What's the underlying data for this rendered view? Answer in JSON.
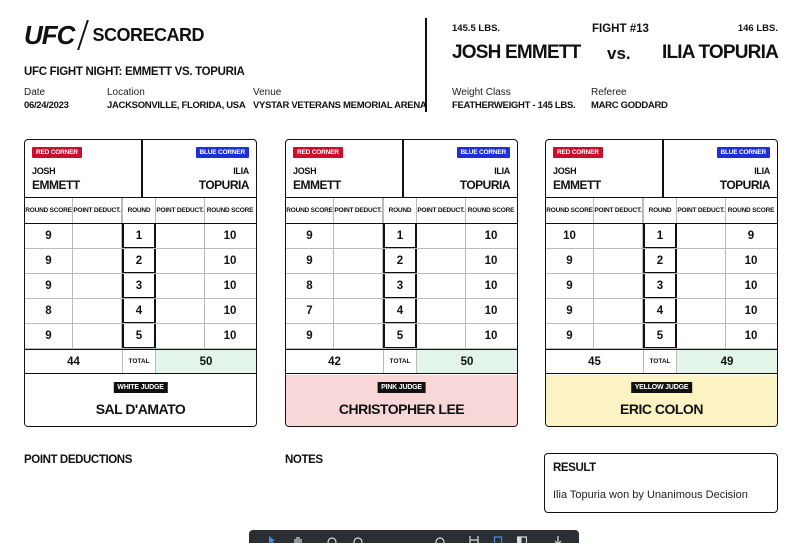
{
  "header": {
    "logo_text": "UFC",
    "logo_sub": "SCORECARD",
    "event_title": "UFC FIGHT NIGHT: EMMETT VS. TOPURIA",
    "date_label": "Date",
    "date_value": "06/24/2023",
    "location_label": "Location",
    "location_value": "JACKSONVILLE, FLORIDA, USA",
    "venue_label": "Venue",
    "venue_value": "VYSTAR VETERANS MEMORIAL ARENA"
  },
  "fight": {
    "red_weight": "145.5 LBS.",
    "fight_number": "FIGHT #13",
    "blue_weight": "146 LBS.",
    "red_name": "JOSH EMMETT",
    "vs": "vs.",
    "blue_name": "ILIA TOPURIA",
    "weight_class_label": "Weight Class",
    "weight_class_value": "FEATHERWEIGHT - 145 LBS.",
    "referee_label": "Referee",
    "referee_value": "MARC GODDARD"
  },
  "card_labels": {
    "red_corner": "RED CORNER",
    "blue_corner": "BLUE CORNER",
    "red_first": "JOSH",
    "red_last": "EMMETT",
    "blue_first": "ILIA",
    "blue_last": "TOPURIA",
    "round_score": "ROUND SCORE",
    "point_deduct": "POINT DEDUCT.",
    "round": "ROUND",
    "total": "TOTAL"
  },
  "cards": [
    {
      "judge_badge": "WHITE JUDGE",
      "judge_name": "SAL D'AMATO",
      "judge_bg": "#ffffff",
      "rounds": [
        {
          "round": "1",
          "red": "9",
          "red_deduct": "",
          "blue_deduct": "",
          "blue": "10"
        },
        {
          "round": "2",
          "red": "9",
          "red_deduct": "",
          "blue_deduct": "",
          "blue": "10"
        },
        {
          "round": "3",
          "red": "9",
          "red_deduct": "",
          "blue_deduct": "",
          "blue": "10"
        },
        {
          "round": "4",
          "red": "8",
          "red_deduct": "",
          "blue_deduct": "",
          "blue": "10"
        },
        {
          "round": "5",
          "red": "9",
          "red_deduct": "",
          "blue_deduct": "",
          "blue": "10"
        }
      ],
      "red_total": "44",
      "blue_total": "50"
    },
    {
      "judge_badge": "PINK JUDGE",
      "judge_name": "CHRISTOPHER LEE",
      "judge_bg": "#f8d7d9",
      "rounds": [
        {
          "round": "1",
          "red": "9",
          "red_deduct": "",
          "blue_deduct": "",
          "blue": "10"
        },
        {
          "round": "2",
          "red": "9",
          "red_deduct": "",
          "blue_deduct": "",
          "blue": "10"
        },
        {
          "round": "3",
          "red": "8",
          "red_deduct": "",
          "blue_deduct": "",
          "blue": "10"
        },
        {
          "round": "4",
          "red": "7",
          "red_deduct": "",
          "blue_deduct": "",
          "blue": "10"
        },
        {
          "round": "5",
          "red": "9",
          "red_deduct": "",
          "blue_deduct": "",
          "blue": "10"
        }
      ],
      "red_total": "42",
      "blue_total": "50"
    },
    {
      "judge_badge": "YELLOW JUDGE",
      "judge_name": "ERIC COLON",
      "judge_bg": "#fbf3c4",
      "rounds": [
        {
          "round": "1",
          "red": "10",
          "red_deduct": "",
          "blue_deduct": "",
          "blue": "9"
        },
        {
          "round": "2",
          "red": "9",
          "red_deduct": "",
          "blue_deduct": "",
          "blue": "10"
        },
        {
          "round": "3",
          "red": "9",
          "red_deduct": "",
          "blue_deduct": "",
          "blue": "10"
        },
        {
          "round": "4",
          "red": "9",
          "red_deduct": "",
          "blue_deduct": "",
          "blue": "10"
        },
        {
          "round": "5",
          "red": "9",
          "red_deduct": "",
          "blue_deduct": "",
          "blue": "10"
        }
      ],
      "red_total": "45",
      "blue_total": "49"
    }
  ],
  "bottom": {
    "point_deductions_title": "POINT DEDUCTIONS",
    "notes_title": "NOTES",
    "result_title": "RESULT",
    "result_text": "Ilia Topuria won by Unanimous Decision"
  },
  "toolbar": {
    "icons": [
      "cursor-icon",
      "hand-icon",
      "zoom-out-icon",
      "zoom-in-icon",
      "stamp-icon",
      "fit-width-icon",
      "page-icon",
      "sidebar-icon",
      "download-icon"
    ]
  },
  "colors": {
    "red_corner": "#c8102e",
    "blue_corner": "#1f2fd6",
    "blue_total_bg": "#e3f4e8"
  }
}
